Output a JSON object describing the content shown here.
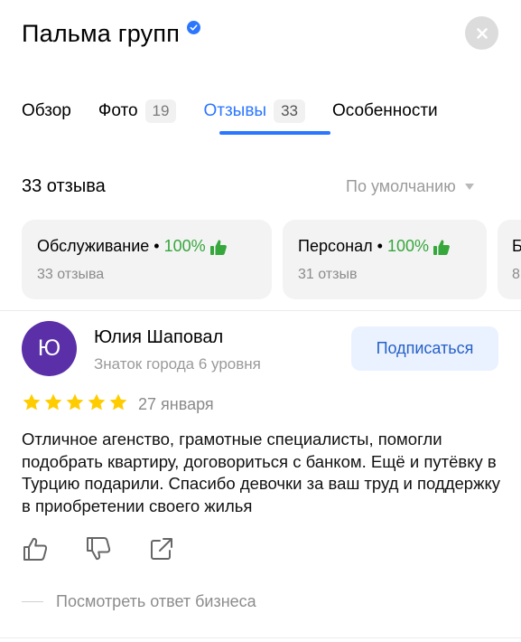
{
  "header": {
    "title": "Пальма групп"
  },
  "tabs": [
    {
      "label": "Обзор",
      "count": null
    },
    {
      "label": "Фото",
      "count": "19"
    },
    {
      "label": "Отзывы",
      "count": "33"
    },
    {
      "label": "Особенности",
      "count": null
    }
  ],
  "reviews_header": {
    "count_label": "33 отзыва",
    "sort_label": "По умолчанию"
  },
  "aspects": [
    {
      "name": "Обслуживание",
      "separator": " • ",
      "percent": "100%",
      "sub": "33 отзыва"
    },
    {
      "name": "Персонал",
      "separator": " • ",
      "percent": "100%",
      "sub": "31 отзыв"
    },
    {
      "name": "Б",
      "separator": "",
      "percent": "",
      "sub": "8"
    }
  ],
  "review": {
    "avatar_letter": "Ю",
    "author": "Юлия Шаповал",
    "level": "Знаток города 6 уровня",
    "subscribe_label": "Подписаться",
    "rating": 5,
    "date": "27 января",
    "text": "Отличное агенство, грамотные специалисты, помогли подобрать квартиру, договориться с банком. Ещё и путёвку в Турцию подарили. Спасибо девочки за ваш труд и поддержку в приобретении своего жилья",
    "business_reply_label": "Посмотреть ответ бизнеса"
  },
  "colors": {
    "accent": "#2b76ff",
    "positive": "#36a73b",
    "star": "#ffcc00",
    "avatar_bg": "#5a2fa8"
  },
  "icons": [
    "verified-check-icon",
    "close-icon",
    "sort-arrow-icon",
    "thumbs-up-icon",
    "star-icon",
    "like-icon",
    "dislike-icon",
    "share-icon"
  ]
}
